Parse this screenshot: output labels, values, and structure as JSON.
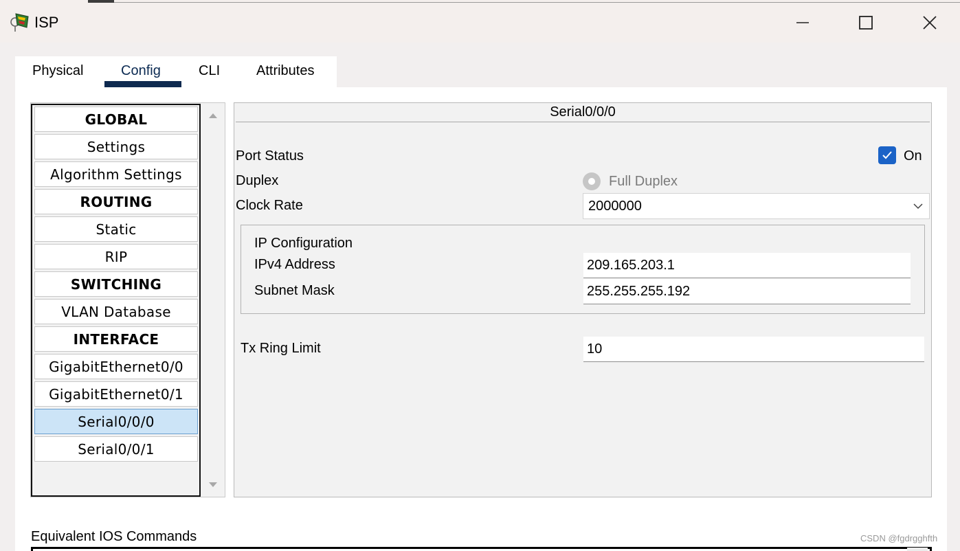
{
  "window": {
    "title": "ISP"
  },
  "tabs": [
    {
      "label": "Physical"
    },
    {
      "label": "Config"
    },
    {
      "label": "CLI"
    },
    {
      "label": "Attributes"
    }
  ],
  "active_tab": "Config",
  "sidebar": {
    "items": [
      {
        "label": "GLOBAL",
        "type": "header"
      },
      {
        "label": "Settings",
        "type": "item"
      },
      {
        "label": "Algorithm Settings",
        "type": "item"
      },
      {
        "label": "ROUTING",
        "type": "header"
      },
      {
        "label": "Static",
        "type": "item"
      },
      {
        "label": "RIP",
        "type": "item"
      },
      {
        "label": "SWITCHING",
        "type": "header"
      },
      {
        "label": "VLAN Database",
        "type": "item"
      },
      {
        "label": "INTERFACE",
        "type": "header"
      },
      {
        "label": "GigabitEthernet0/0",
        "type": "item"
      },
      {
        "label": "GigabitEthernet0/1",
        "type": "item"
      },
      {
        "label": "Serial0/0/0",
        "type": "item",
        "selected": true
      },
      {
        "label": "Serial0/0/1",
        "type": "item"
      }
    ]
  },
  "interface": {
    "title": "Serial0/0/0",
    "port_status_label": "Port Status",
    "port_status_on": true,
    "port_status_value": "On",
    "duplex_label": "Duplex",
    "duplex_value": "Full Duplex",
    "clock_rate_label": "Clock Rate",
    "clock_rate_value": "2000000",
    "ip_config": {
      "title": "IP Configuration",
      "ipv4_label": "IPv4 Address",
      "ipv4_value": "209.165.203.1",
      "mask_label": "Subnet Mask",
      "mask_value": "255.255.255.192"
    },
    "tx_ring_label": "Tx Ring Limit",
    "tx_ring_value": "10"
  },
  "footer": {
    "ios_label": "Equivalent IOS Commands",
    "watermark": "CSDN @fgdrgghfth"
  },
  "colors": {
    "accent": "#1b63c7",
    "selected_row": "#cce4f7",
    "tab_underline": "#0e2a4f"
  }
}
